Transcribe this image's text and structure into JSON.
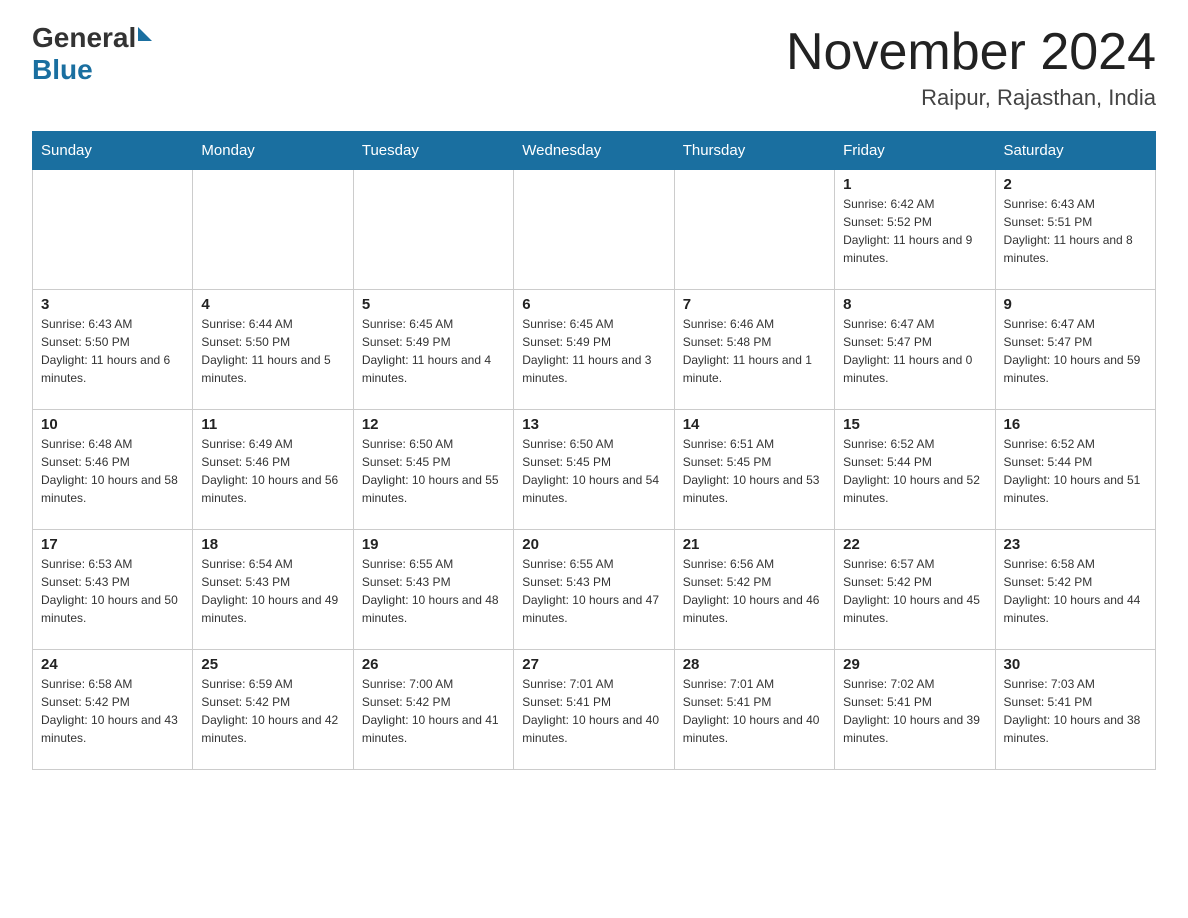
{
  "header": {
    "logo_general": "General",
    "logo_blue": "Blue",
    "month_title": "November 2024",
    "location": "Raipur, Rajasthan, India"
  },
  "weekdays": [
    "Sunday",
    "Monday",
    "Tuesday",
    "Wednesday",
    "Thursday",
    "Friday",
    "Saturday"
  ],
  "weeks": [
    [
      {
        "day": "",
        "sunrise": "",
        "sunset": "",
        "daylight": ""
      },
      {
        "day": "",
        "sunrise": "",
        "sunset": "",
        "daylight": ""
      },
      {
        "day": "",
        "sunrise": "",
        "sunset": "",
        "daylight": ""
      },
      {
        "day": "",
        "sunrise": "",
        "sunset": "",
        "daylight": ""
      },
      {
        "day": "",
        "sunrise": "",
        "sunset": "",
        "daylight": ""
      },
      {
        "day": "1",
        "sunrise": "Sunrise: 6:42 AM",
        "sunset": "Sunset: 5:52 PM",
        "daylight": "Daylight: 11 hours and 9 minutes."
      },
      {
        "day": "2",
        "sunrise": "Sunrise: 6:43 AM",
        "sunset": "Sunset: 5:51 PM",
        "daylight": "Daylight: 11 hours and 8 minutes."
      }
    ],
    [
      {
        "day": "3",
        "sunrise": "Sunrise: 6:43 AM",
        "sunset": "Sunset: 5:50 PM",
        "daylight": "Daylight: 11 hours and 6 minutes."
      },
      {
        "day": "4",
        "sunrise": "Sunrise: 6:44 AM",
        "sunset": "Sunset: 5:50 PM",
        "daylight": "Daylight: 11 hours and 5 minutes."
      },
      {
        "day": "5",
        "sunrise": "Sunrise: 6:45 AM",
        "sunset": "Sunset: 5:49 PM",
        "daylight": "Daylight: 11 hours and 4 minutes."
      },
      {
        "day": "6",
        "sunrise": "Sunrise: 6:45 AM",
        "sunset": "Sunset: 5:49 PM",
        "daylight": "Daylight: 11 hours and 3 minutes."
      },
      {
        "day": "7",
        "sunrise": "Sunrise: 6:46 AM",
        "sunset": "Sunset: 5:48 PM",
        "daylight": "Daylight: 11 hours and 1 minute."
      },
      {
        "day": "8",
        "sunrise": "Sunrise: 6:47 AM",
        "sunset": "Sunset: 5:47 PM",
        "daylight": "Daylight: 11 hours and 0 minutes."
      },
      {
        "day": "9",
        "sunrise": "Sunrise: 6:47 AM",
        "sunset": "Sunset: 5:47 PM",
        "daylight": "Daylight: 10 hours and 59 minutes."
      }
    ],
    [
      {
        "day": "10",
        "sunrise": "Sunrise: 6:48 AM",
        "sunset": "Sunset: 5:46 PM",
        "daylight": "Daylight: 10 hours and 58 minutes."
      },
      {
        "day": "11",
        "sunrise": "Sunrise: 6:49 AM",
        "sunset": "Sunset: 5:46 PM",
        "daylight": "Daylight: 10 hours and 56 minutes."
      },
      {
        "day": "12",
        "sunrise": "Sunrise: 6:50 AM",
        "sunset": "Sunset: 5:45 PM",
        "daylight": "Daylight: 10 hours and 55 minutes."
      },
      {
        "day": "13",
        "sunrise": "Sunrise: 6:50 AM",
        "sunset": "Sunset: 5:45 PM",
        "daylight": "Daylight: 10 hours and 54 minutes."
      },
      {
        "day": "14",
        "sunrise": "Sunrise: 6:51 AM",
        "sunset": "Sunset: 5:45 PM",
        "daylight": "Daylight: 10 hours and 53 minutes."
      },
      {
        "day": "15",
        "sunrise": "Sunrise: 6:52 AM",
        "sunset": "Sunset: 5:44 PM",
        "daylight": "Daylight: 10 hours and 52 minutes."
      },
      {
        "day": "16",
        "sunrise": "Sunrise: 6:52 AM",
        "sunset": "Sunset: 5:44 PM",
        "daylight": "Daylight: 10 hours and 51 minutes."
      }
    ],
    [
      {
        "day": "17",
        "sunrise": "Sunrise: 6:53 AM",
        "sunset": "Sunset: 5:43 PM",
        "daylight": "Daylight: 10 hours and 50 minutes."
      },
      {
        "day": "18",
        "sunrise": "Sunrise: 6:54 AM",
        "sunset": "Sunset: 5:43 PM",
        "daylight": "Daylight: 10 hours and 49 minutes."
      },
      {
        "day": "19",
        "sunrise": "Sunrise: 6:55 AM",
        "sunset": "Sunset: 5:43 PM",
        "daylight": "Daylight: 10 hours and 48 minutes."
      },
      {
        "day": "20",
        "sunrise": "Sunrise: 6:55 AM",
        "sunset": "Sunset: 5:43 PM",
        "daylight": "Daylight: 10 hours and 47 minutes."
      },
      {
        "day": "21",
        "sunrise": "Sunrise: 6:56 AM",
        "sunset": "Sunset: 5:42 PM",
        "daylight": "Daylight: 10 hours and 46 minutes."
      },
      {
        "day": "22",
        "sunrise": "Sunrise: 6:57 AM",
        "sunset": "Sunset: 5:42 PM",
        "daylight": "Daylight: 10 hours and 45 minutes."
      },
      {
        "day": "23",
        "sunrise": "Sunrise: 6:58 AM",
        "sunset": "Sunset: 5:42 PM",
        "daylight": "Daylight: 10 hours and 44 minutes."
      }
    ],
    [
      {
        "day": "24",
        "sunrise": "Sunrise: 6:58 AM",
        "sunset": "Sunset: 5:42 PM",
        "daylight": "Daylight: 10 hours and 43 minutes."
      },
      {
        "day": "25",
        "sunrise": "Sunrise: 6:59 AM",
        "sunset": "Sunset: 5:42 PM",
        "daylight": "Daylight: 10 hours and 42 minutes."
      },
      {
        "day": "26",
        "sunrise": "Sunrise: 7:00 AM",
        "sunset": "Sunset: 5:42 PM",
        "daylight": "Daylight: 10 hours and 41 minutes."
      },
      {
        "day": "27",
        "sunrise": "Sunrise: 7:01 AM",
        "sunset": "Sunset: 5:41 PM",
        "daylight": "Daylight: 10 hours and 40 minutes."
      },
      {
        "day": "28",
        "sunrise": "Sunrise: 7:01 AM",
        "sunset": "Sunset: 5:41 PM",
        "daylight": "Daylight: 10 hours and 40 minutes."
      },
      {
        "day": "29",
        "sunrise": "Sunrise: 7:02 AM",
        "sunset": "Sunset: 5:41 PM",
        "daylight": "Daylight: 10 hours and 39 minutes."
      },
      {
        "day": "30",
        "sunrise": "Sunrise: 7:03 AM",
        "sunset": "Sunset: 5:41 PM",
        "daylight": "Daylight: 10 hours and 38 minutes."
      }
    ]
  ]
}
